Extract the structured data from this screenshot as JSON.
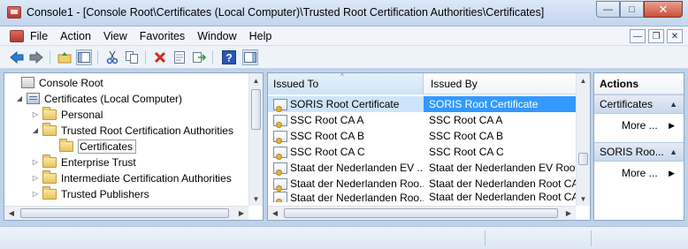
{
  "window": {
    "title": "Console1 - [Console Root\\Certificates (Local Computer)\\Trusted Root Certification Authorities\\Certificates]",
    "controls": {
      "minimize": "—",
      "maximize": "□",
      "close": "✕"
    }
  },
  "menu": {
    "items": [
      {
        "label": "File"
      },
      {
        "label": "Action"
      },
      {
        "label": "View"
      },
      {
        "label": "Favorites"
      },
      {
        "label": "Window"
      },
      {
        "label": "Help"
      }
    ],
    "mdi": {
      "minimize": "—",
      "restore": "❐",
      "close": "✕"
    }
  },
  "toolbar": {
    "icons": [
      "back-arrow-icon",
      "forward-arrow-icon",
      "up-folder-icon",
      "show-hide-tree-icon",
      "cut-icon",
      "copy-icon",
      "delete-icon",
      "properties-icon",
      "export-icon",
      "help-icon",
      "show-hide-action-pane-icon"
    ]
  },
  "tree": {
    "items": [
      {
        "label": "Console Root",
        "icon": "console-icon",
        "expander": ""
      },
      {
        "label": "Certificates (Local Computer)",
        "icon": "cert-store-icon",
        "expander": "◢"
      },
      {
        "label": "Personal",
        "icon": "folder-icon",
        "expander": "▷"
      },
      {
        "label": "Trusted Root Certification Authorities",
        "icon": "folder-icon",
        "expander": "◢"
      },
      {
        "label": "Certificates",
        "icon": "folder-open-icon",
        "expander": "",
        "selected": true
      },
      {
        "label": "Enterprise Trust",
        "icon": "folder-icon",
        "expander": "▷"
      },
      {
        "label": "Intermediate Certification Authorities",
        "icon": "folder-icon",
        "expander": "▷"
      },
      {
        "label": "Trusted Publishers",
        "icon": "folder-icon",
        "expander": "▷"
      }
    ]
  },
  "list": {
    "columns": [
      {
        "label": "Issued To",
        "sorted": true
      },
      {
        "label": "Issued By"
      }
    ],
    "rows": [
      {
        "issued_to": "SORIS Root Certificate",
        "issued_by": "SORIS Root Certificate",
        "selected": true
      },
      {
        "issued_to": "SSC Root CA A",
        "issued_by": "SSC Root CA A"
      },
      {
        "issued_to": "SSC Root CA B",
        "issued_by": "SSC Root CA B"
      },
      {
        "issued_to": "SSC Root CA C",
        "issued_by": "SSC Root CA C"
      },
      {
        "issued_to": "Staat der Nederlanden EV ...",
        "issued_by": "Staat der Nederlanden EV Root"
      },
      {
        "issued_to": "Staat der Nederlanden Roo...",
        "issued_by": "Staat der Nederlanden Root CA"
      },
      {
        "issued_to": "Staat der Nederlanden Roo...",
        "issued_by": "Staat der Nederlanden Root CA"
      }
    ]
  },
  "actions": {
    "header": "Actions",
    "groups": [
      {
        "title": "Certificates",
        "items": [
          {
            "label": "More ..."
          }
        ]
      },
      {
        "title": "SORIS Roo...",
        "items": [
          {
            "label": "More ..."
          }
        ]
      }
    ]
  }
}
